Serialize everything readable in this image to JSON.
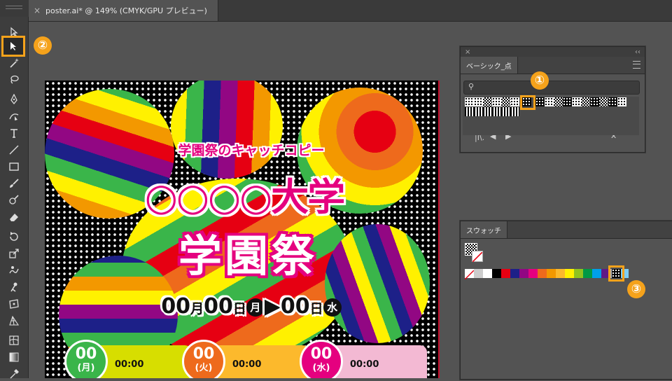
{
  "document": {
    "tab_title": "poster.ai* @ 149% (CMYK/GPU プレビュー)",
    "close": "×"
  },
  "poster": {
    "catch_copy": "学園祭のキャッチコピー",
    "university": "○○○○大学",
    "festival": "学園祭",
    "date": {
      "month1": "00",
      "month_unit": "月",
      "day1": "00",
      "day_unit": "日",
      "weekday1": "月",
      "arrow": "▶",
      "day2": "00",
      "day2_unit": "日",
      "weekday2": "水"
    },
    "days": [
      {
        "num": "00",
        "weekday": "(月)",
        "time": "00:00",
        "circle_color": "#3ab54a",
        "box_color": "#d7de00"
      },
      {
        "num": "00",
        "weekday": "(火)",
        "time": "00:00",
        "circle_color": "#ee6a1c",
        "box_color": "#fcb92c"
      },
      {
        "num": "00",
        "weekday": "(水)",
        "time": "00:00",
        "circle_color": "#e5007f",
        "box_color": "#f3b9d3"
      }
    ]
  },
  "pattern_panel": {
    "title": "ベーシック_点",
    "search_placeholder": "",
    "badge": "①"
  },
  "swatch_panel": {
    "title": "スウォッチ",
    "badge": "③",
    "colors": [
      "#ffffff",
      "#000000",
      "#e60012",
      "#1d2088",
      "#920783",
      "#e5007f",
      "#ee6a1c",
      "#f39800",
      "#fcb92c",
      "#fff100",
      "#8fc31f",
      "#009944",
      "#00a0e9",
      "#601986",
      "#b5b5b6",
      "#7ecef4"
    ]
  },
  "toolbar": {
    "badge": "②",
    "tools": [
      "direct-selection",
      "selection",
      "magic-wand",
      "lasso",
      "pen",
      "curvature",
      "type",
      "line",
      "rectangle",
      "paintbrush",
      "shaper",
      "eraser",
      "rotate",
      "scale",
      "warp",
      "puppet-warp",
      "free-transform",
      "perspective-grid",
      "mesh",
      "gradient",
      "eyedropper"
    ]
  },
  "colors": {
    "accent_orange": "#f5a21b",
    "magenta": "#e5007f",
    "ui_dark": "#3d3d3d",
    "ui_mid": "#535353"
  }
}
